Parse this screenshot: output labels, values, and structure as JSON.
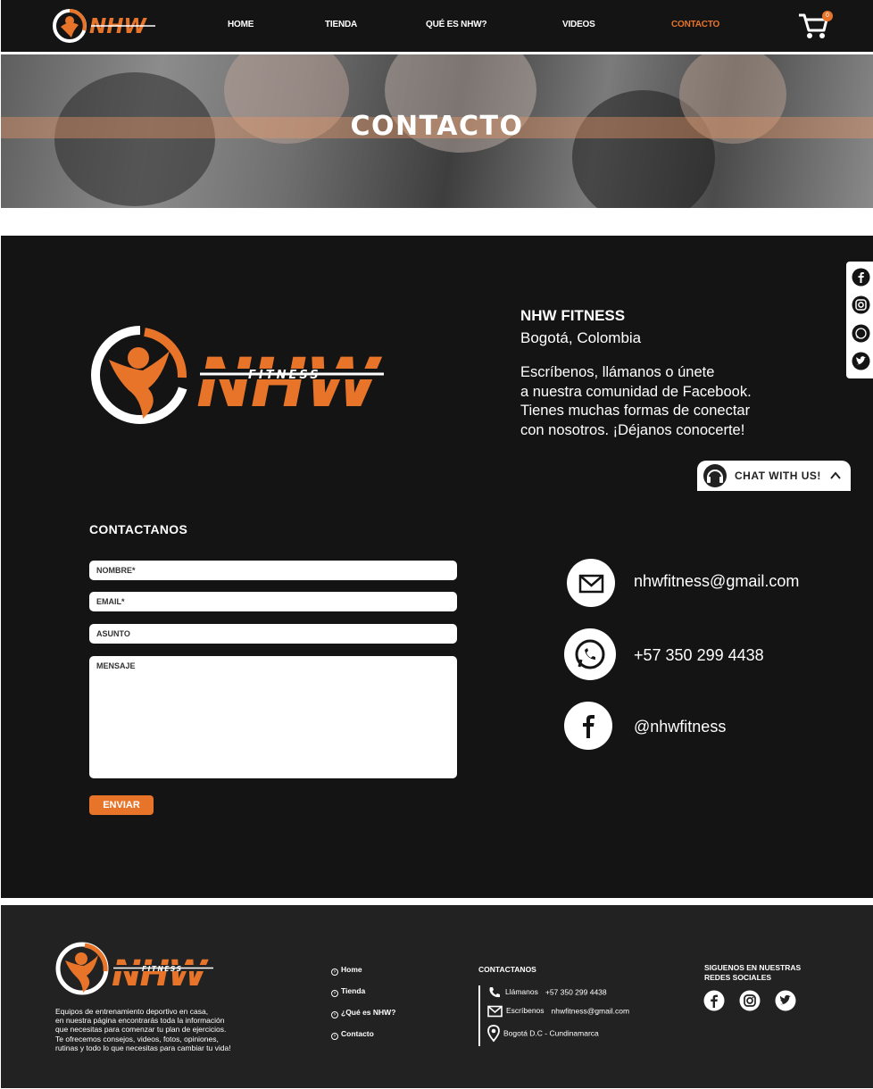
{
  "nav": {
    "logo_text": "NHW",
    "logo_sub": "FITNESS",
    "items": [
      {
        "label": "HOME"
      },
      {
        "label": "TIENDA"
      },
      {
        "label": "QUÉ ES NHW?"
      },
      {
        "label": "VIDEOS"
      },
      {
        "label": "CONTACTO"
      }
    ],
    "cart_count": "0"
  },
  "hero": {
    "title": "CONTACTO"
  },
  "company": {
    "name": "NHW FITNESS",
    "city": "Bogotá, Colombia",
    "description": "Escríbenos, llámanos o únete\na nuestra comunidad de Facebook.\nTienes muchas formas de conectar\ncon nosotros. ¡Déjanos conocerte!"
  },
  "chat": {
    "label": "CHAT WITH US!"
  },
  "form": {
    "title": "CONTACTANOS",
    "name_placeholder": "NOMBRE*",
    "email_placeholder": "EMAIL*",
    "subject_placeholder": "ASUNTO",
    "message_placeholder": "MENSAJE",
    "send_label": "ENVIAR"
  },
  "contacts": {
    "email": "nhwfitness@gmail.com",
    "phone": "+57 350 299 4438",
    "facebook": "@nhwfitness"
  },
  "footer": {
    "description": "Equipos de entrenamiento deportivo en casa,\nen nuestra página encontrarás toda la información\nque necesitas para comenzar tu plan de ejercicios.\nTe ofrecemos consejos, videos, fotos, opiniones,\nrutinas y todo lo que necesitas para cambiar tu vida!",
    "links": [
      {
        "label": "Home"
      },
      {
        "label": "Tienda"
      },
      {
        "label": "¿Qué es NHW?"
      },
      {
        "label": "Contacto"
      }
    ],
    "contact_title": "CONTACTANOS",
    "call_label": "Llámanos",
    "call_value": "+57 350 299 4438",
    "write_label": "Escríbenos",
    "write_value": "nhwfitness@gmail.com",
    "address": "Bogotá D.C - Cundinamarca",
    "social_title_1": "SIGUENOS EN NUESTRAS",
    "social_title_2": "REDES SOCIALES"
  },
  "colors": {
    "accent": "#e8742a",
    "dark": "#141414",
    "footer": "#222222"
  },
  "icons": [
    "cart-icon",
    "facebook-icon",
    "instagram-icon",
    "whatsapp-icon",
    "twitter-icon",
    "mail-icon",
    "phone-icon",
    "location-icon",
    "headset-icon",
    "chevron-up-icon"
  ]
}
